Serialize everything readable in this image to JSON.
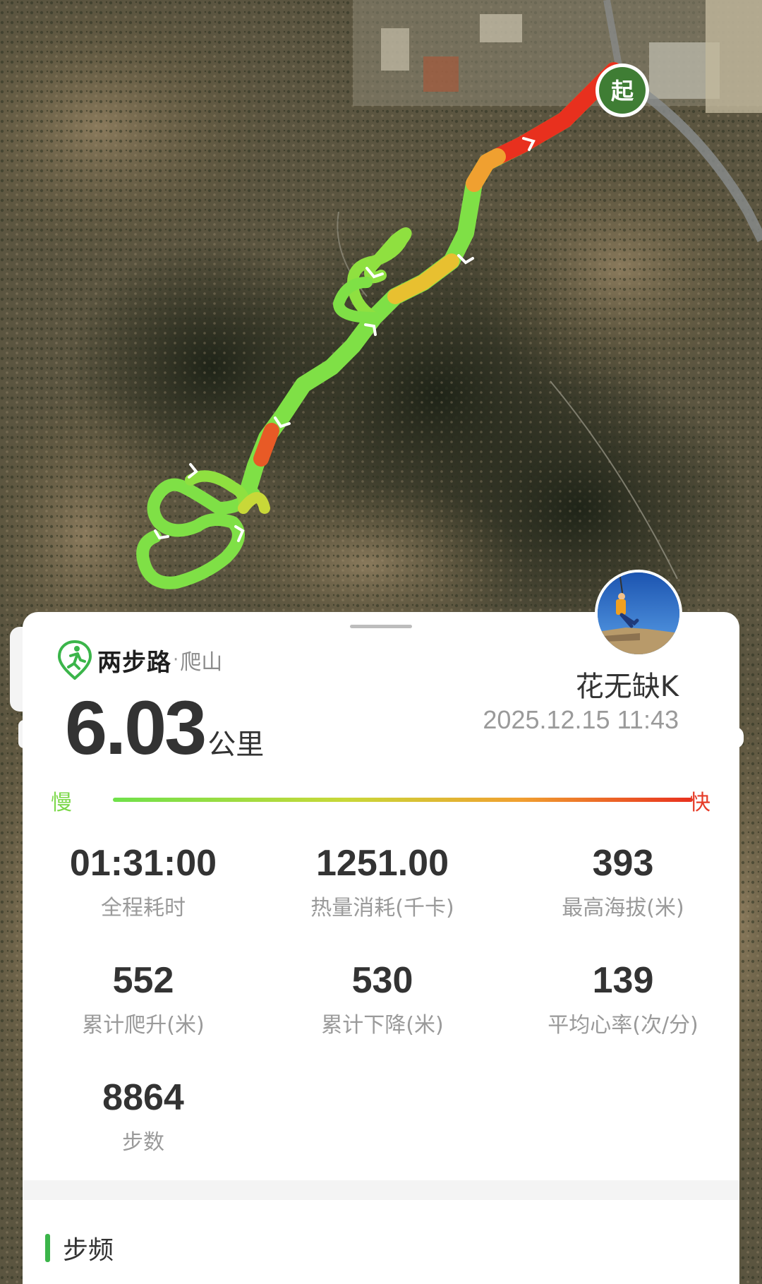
{
  "map": {
    "start_marker": "起",
    "start_marker_color": "#3f7d34",
    "route_colors": [
      "#6fe14a",
      "#c8d838",
      "#f0a030",
      "#e8301e"
    ],
    "direction_arrow_icon": "chevron-arrow-icon"
  },
  "card": {
    "brand_name": "两步路",
    "brand_separator": "·",
    "activity": "爬山",
    "brand_color": "#3bb54a",
    "distance": "6.03",
    "distance_unit": "公里",
    "username": "花无缺K",
    "datetime": "2025.12.15 11:43",
    "avatar_icon": "user-avatar"
  },
  "speed_scale": {
    "slow_label": "慢",
    "fast_label": "快"
  },
  "stats": [
    {
      "value": "01:31:00",
      "label": "全程耗时"
    },
    {
      "value": "1251.00",
      "label": "热量消耗(千卡)"
    },
    {
      "value": "393",
      "label": "最高海拔(米)"
    },
    {
      "value": "552",
      "label": "累计爬升(米)"
    },
    {
      "value": "530",
      "label": "累计下降(米)"
    },
    {
      "value": "139",
      "label": "平均心率(次/分)"
    },
    {
      "value": "8864",
      "label": "步数"
    }
  ],
  "section": {
    "title": "步频"
  }
}
